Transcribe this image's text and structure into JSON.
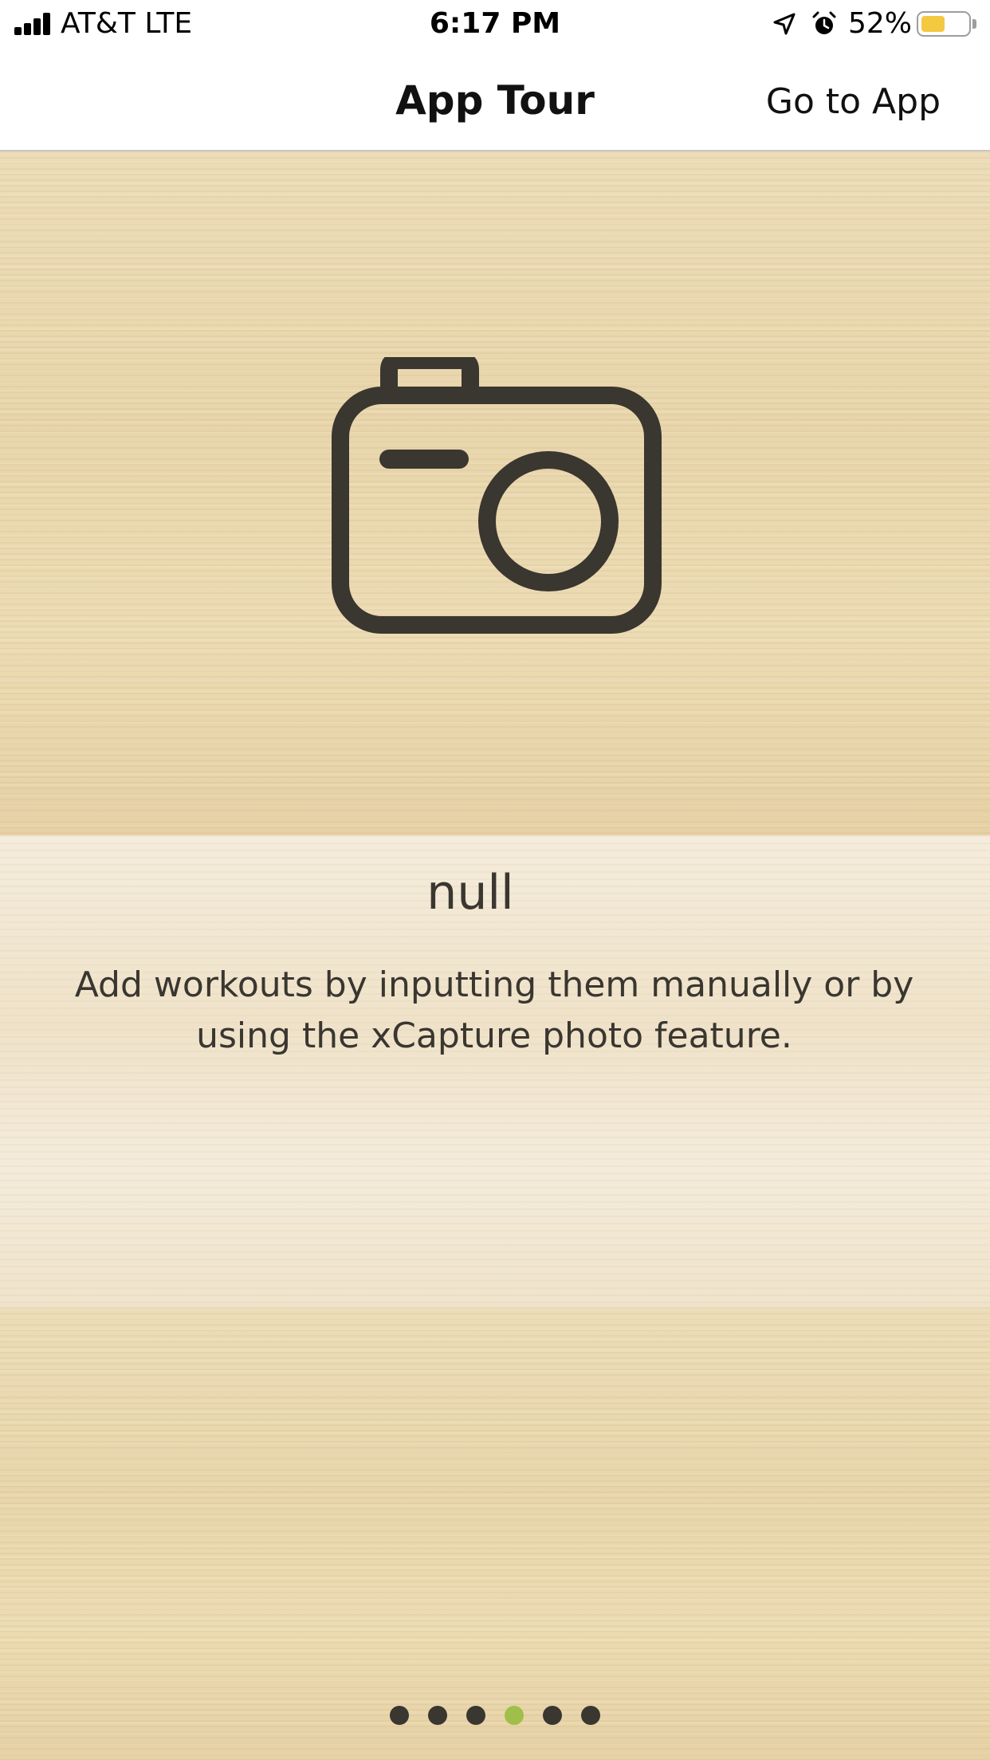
{
  "status_bar": {
    "carrier": "AT&T   LTE",
    "time": "6:17 PM",
    "battery_percent": "52%",
    "battery_level": 0.52,
    "battery_color": "#f5c842",
    "icons": [
      "signal-icon",
      "location-icon",
      "alarm-icon",
      "battery-icon"
    ]
  },
  "nav": {
    "title": "App Tour",
    "action_label": "Go to App"
  },
  "slide": {
    "icon": "camera-icon",
    "title": "null",
    "description": "Add workouts by inputting them manually or by using the xCapture photo feature."
  },
  "pager": {
    "total": 6,
    "current": 4,
    "active_color": "#9fbf4a",
    "inactive_color": "#3a3630"
  }
}
